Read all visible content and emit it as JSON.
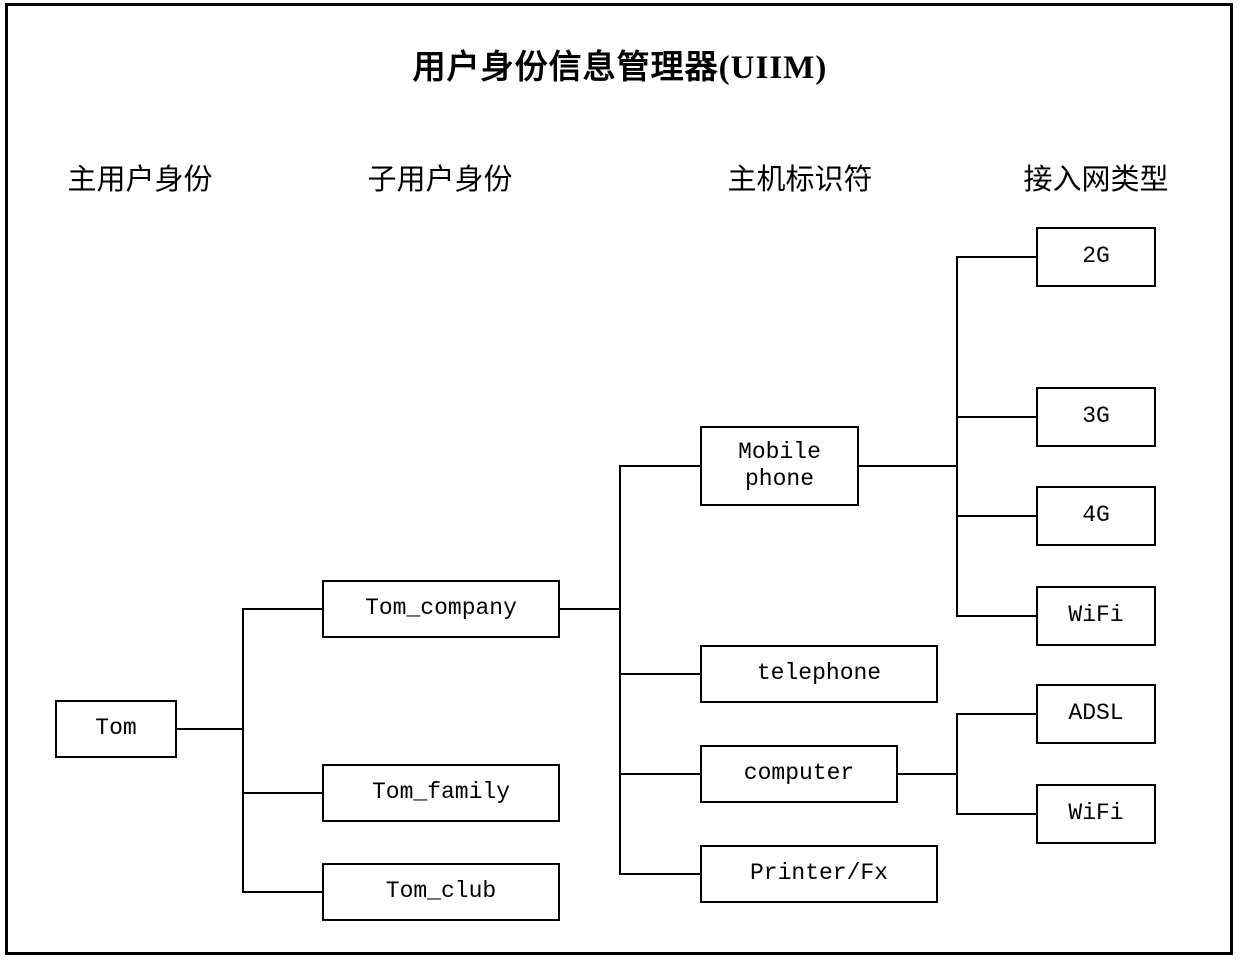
{
  "title": "用户身份信息管理器(UIIM)",
  "columns": [
    {
      "label": "主用户身份",
      "key": "primary-user-identity"
    },
    {
      "label": "子用户身份",
      "key": "sub-user-identity"
    },
    {
      "label": "主机标识符",
      "key": "host-identifier"
    },
    {
      "label": "接入网类型",
      "key": "access-network-type"
    }
  ],
  "nodes": {
    "root": {
      "label": "Tom"
    },
    "sub_users": [
      {
        "label": "Tom_company"
      },
      {
        "label": "Tom_family"
      },
      {
        "label": "Tom_club"
      }
    ],
    "hosts": [
      {
        "label": "Mobile\nphone"
      },
      {
        "label": "telephone"
      },
      {
        "label": "computer"
      },
      {
        "label": "Printer/Fx"
      }
    ],
    "mobile_networks": [
      {
        "label": "2G"
      },
      {
        "label": "3G"
      },
      {
        "label": "4G"
      },
      {
        "label": "WiFi"
      }
    ],
    "computer_networks": [
      {
        "label": "ADSL"
      },
      {
        "label": "WiFi"
      }
    ]
  },
  "chart_data": {
    "type": "table",
    "title": "用户身份信息管理器(UIIM)",
    "columns": [
      "主用户身份",
      "子用户身份",
      "主机标识符",
      "接入网类型"
    ],
    "tree": {
      "name": "Tom",
      "children": [
        {
          "name": "Tom_company",
          "children": [
            {
              "name": "Mobile phone",
              "children": [
                {
                  "name": "2G"
                },
                {
                  "name": "3G"
                },
                {
                  "name": "4G"
                },
                {
                  "name": "WiFi"
                }
              ]
            },
            {
              "name": "telephone"
            },
            {
              "name": "computer",
              "children": [
                {
                  "name": "ADSL"
                },
                {
                  "name": "WiFi"
                }
              ]
            },
            {
              "name": "Printer/Fx"
            }
          ]
        },
        {
          "name": "Tom_family"
        },
        {
          "name": "Tom_club"
        }
      ]
    }
  },
  "colors": {
    "line": "#000000",
    "text": "#000000",
    "background": "#ffffff"
  }
}
